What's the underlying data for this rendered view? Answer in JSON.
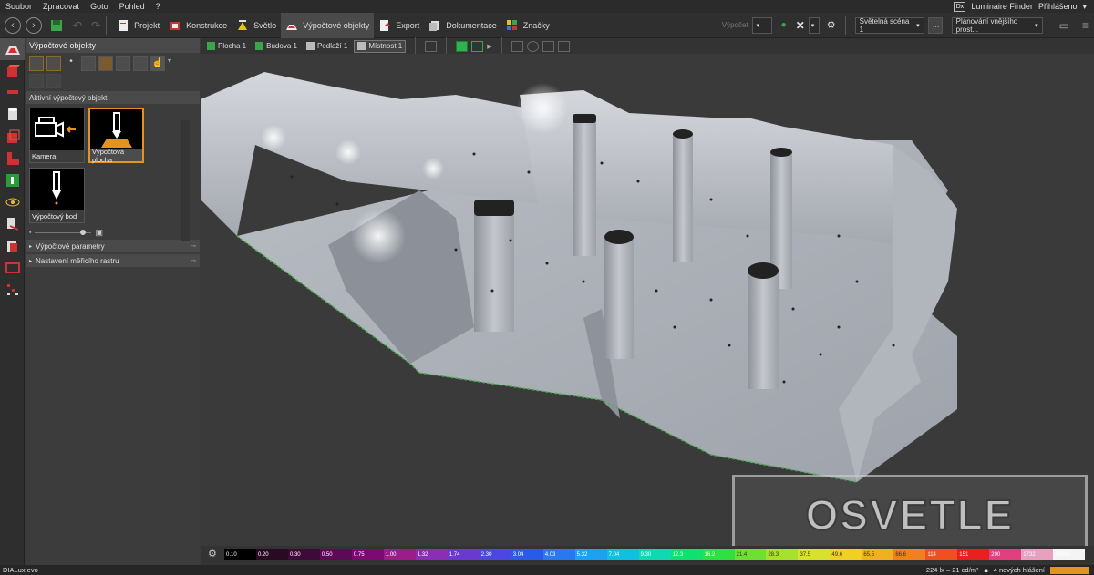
{
  "menu": {
    "items": [
      "Soubor",
      "Zpracovat",
      "Goto",
      "Pohled",
      "?"
    ],
    "logo_text": "Dx",
    "luminaire_finder": "Luminaire Finder",
    "login": "Přihlášeno"
  },
  "toolbar": {
    "tabs": [
      {
        "label": "Projekt",
        "icon": "project-icon"
      },
      {
        "label": "Konstrukce",
        "icon": "construction-icon"
      },
      {
        "label": "Světlo",
        "icon": "light-icon"
      },
      {
        "label": "Výpočtové objekty",
        "icon": "calc-objects-icon",
        "active": true
      },
      {
        "label": "Export",
        "icon": "export-icon"
      },
      {
        "label": "Dokumentace",
        "icon": "documentation-icon"
      },
      {
        "label": "Značky",
        "icon": "marks-icon"
      }
    ],
    "calc_label": "Výpočet",
    "light_scene": "Světelná scéna 1",
    "planning": "Plánování vnějšího prost..."
  },
  "panel": {
    "title": "Výpočtové objekty",
    "active_section": "Aktivní výpočtový objekt",
    "objects": [
      {
        "label": "Kamera",
        "selected": false
      },
      {
        "label": "Výpočtová plocha",
        "selected": true
      },
      {
        "label": "Výpočtový bod",
        "selected": false
      }
    ],
    "sections": [
      "Výpočtové parametry",
      "Nastavení měřicího rastru"
    ]
  },
  "viewtabs": [
    "Plocha 1",
    "Budova 1",
    "Podlaží 1",
    "Místnost 1"
  ],
  "legend": {
    "values": [
      "0.10",
      "0.20",
      "0.30",
      "0.50",
      "0.75",
      "1.00",
      "1.32",
      "1.74",
      "2.30",
      "3.04",
      "4.03",
      "5.32",
      "7.04",
      "9.30",
      "12.3",
      "16.2",
      "21.4",
      "28.3",
      "37.5",
      "49.6",
      "65.5",
      "86.6",
      "114",
      "151",
      "200",
      "1732",
      "15000"
    ],
    "colors": [
      "#000000",
      "#2a0a22",
      "#3d0a3a",
      "#5c0a55",
      "#7d0a72",
      "#9a1d8a",
      "#8a2fb5",
      "#6a3ad0",
      "#4a48e0",
      "#2a5ae8",
      "#2a78f0",
      "#1fa0f0",
      "#10c0e0",
      "#10d8b0",
      "#10e070",
      "#30e040",
      "#70e030",
      "#a8e030",
      "#d8e030",
      "#f0d020",
      "#f0b020",
      "#f08020",
      "#f05020",
      "#e82020",
      "#e04080",
      "#e8a0c0",
      "#f4f4f4"
    ]
  },
  "status": {
    "brand": "DIALux evo",
    "reading": "224 lx – 21 cd/m²",
    "messages": "4 nových hlášení"
  },
  "watermark": "OSVETLE"
}
